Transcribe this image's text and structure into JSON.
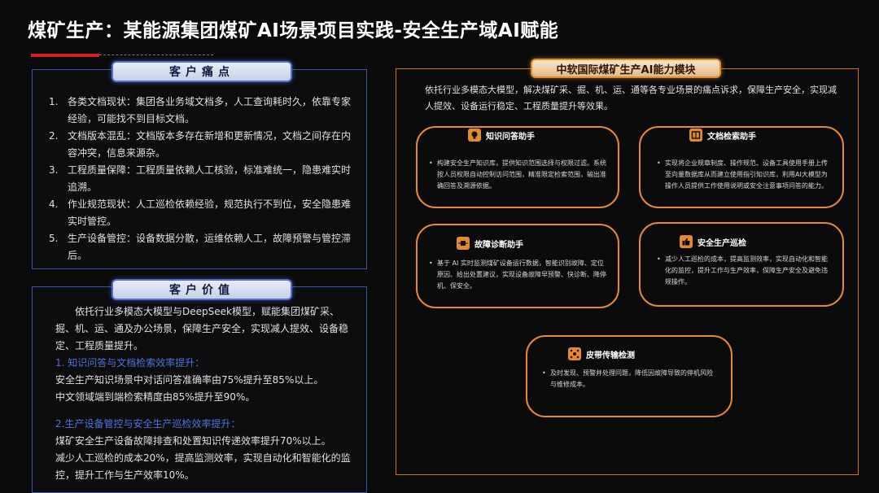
{
  "header": {
    "title": "煤矿生产：某能源集团煤矿AI场景项目实践-安全生产域AI赋能"
  },
  "pain_points": {
    "tag": "客户痛点",
    "items": [
      {
        "num": "1.",
        "text": "各类文档现状：集团各业务域文档多，人工查询耗时久，依靠专家经验，可能找不到目标文档。"
      },
      {
        "num": "2.",
        "text": "文档版本混乱：文档版本多存在新增和更新情况，文档之间存在内容冲突，信息来源杂。"
      },
      {
        "num": "3.",
        "text": "工程质量保障：工程质量依赖人工核验，标准难统一，隐患难实时追溯。"
      },
      {
        "num": "4.",
        "text": "作业规范现状：人工巡检依赖经验，规范执行不到位，安全隐患难实时管控。"
      },
      {
        "num": "5.",
        "text": "生产设备管控：设备数据分散，运维依赖人工，故障预警与管控滞后。"
      }
    ]
  },
  "customer_value": {
    "tag": "客户价值",
    "intro": "依托行业多模态大模型与DeepSeek模型，赋能集团煤矿采、掘、机、运、通及办公场景，保障生产安全，实现减人提效、设备稳定、工程质量提升。",
    "section1_title": "1. 知识问答与文档检索效率提升：",
    "section1_lines": [
      "安全生产知识场景中对话问答准确率由75%提升至85%以上。",
      "中文领域端到端检索精度由85%提升至90%。"
    ],
    "section2_title": "2.生产设备管控与安全生产巡检效率提升：",
    "section2_lines": [
      "煤矿安全生产设备故障排查和处置知识传递效率提升70%以上。",
      "减少人工巡检的成本20%，提高监测效率，实现自动化和智能化的监控，提升工作与生产效率10%。"
    ]
  },
  "module": {
    "tag": "中软国际煤矿生产AI能力模块",
    "intro": "依托行业多模态大模型，解决煤矿采、掘、机、运、通等各专业场景的痛点诉求，保障生产安全，实现减人提效、设备运行稳定、工程质量提升等效果。",
    "cards": {
      "qa": {
        "title": "知识问答助手",
        "icon": "chat-bulb-icon",
        "text": "构建安全生产知识库，提供知识范围选择与权限过滤。系统按人员权限自动控制访问范围，精准限定检索范围，输出准确回答及溯源依据。"
      },
      "search": {
        "title": "文档检索助手",
        "icon": "book-search-icon",
        "text": "实现将企业规章制度、操作规范、设备工具使用手册上传至向量数据库从而建立使用指引知识库，利用AI大模型为操作人员提供工作使用说明或安全注意事项问答的能力。"
      },
      "diag": {
        "title": "故障诊断助手",
        "icon": "circuit-icon",
        "text": "基于 AI 实时监测煤矿设备运行数据，智能识别故障、定位原因、给出处置建议，实现设备故障早预警、快诊断、降停机、保安全。"
      },
      "patrol": {
        "title": "安全生产巡检",
        "icon": "thumbs-up-icon",
        "text": "减少人工巡检的成本，提高监测效率，实现自动化和智能化的监控，提升工作与生产效率，保障生产安全及避免违规操作。"
      },
      "belt": {
        "title": "皮带传输检测",
        "icon": "network-icon",
        "text": "及时发现、预警并处理问题，降低因故障导致的停机风险与维修成本。"
      }
    }
  },
  "colors": {
    "accent_blue": "#3b55a8",
    "accent_orange": "#e68a2e",
    "title_red": "#d0231f"
  }
}
